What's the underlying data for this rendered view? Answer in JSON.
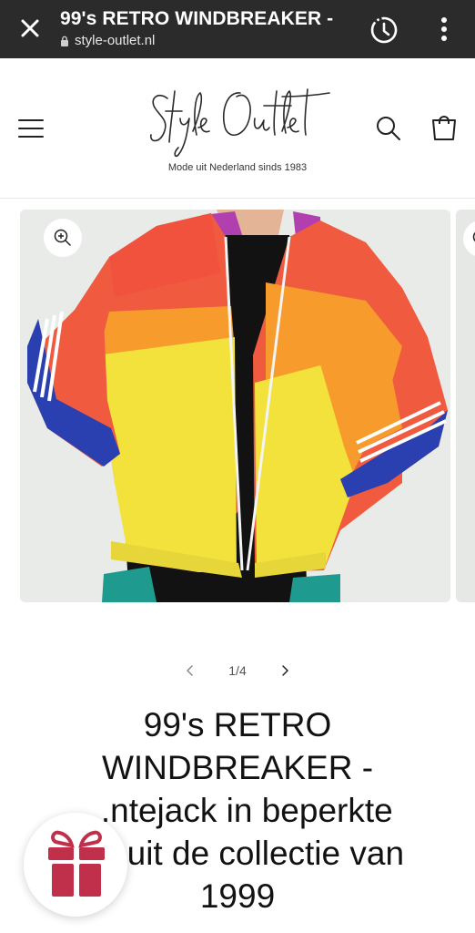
{
  "browser": {
    "title": "99's RETRO WINDBREAKER -",
    "url": "style-outlet.nl"
  },
  "store": {
    "logo_text": "Style Outlet",
    "tagline": "Mode uit Nederland sinds 1983"
  },
  "gallery": {
    "current": "1/4"
  },
  "product": {
    "title_lines": [
      "99's RETRO",
      "WINDBREAKER -",
      "...ntejack in beperkte",
      "...e uit de collectie van",
      "1999"
    ]
  },
  "colors": {
    "topbar": "#2b2b2b",
    "gift": "#c0304a"
  }
}
